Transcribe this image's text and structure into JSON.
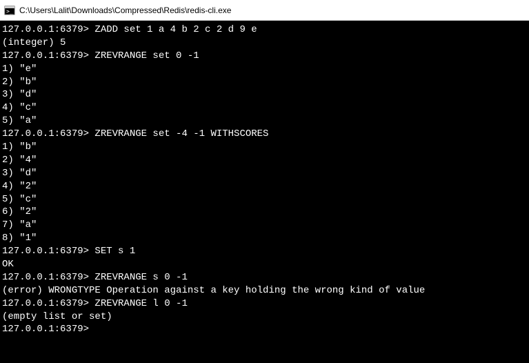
{
  "titlebar": {
    "path": "C:\\Users\\Lalit\\Downloads\\Compressed\\Redis\\redis-cli.exe"
  },
  "terminal": {
    "prompt": "127.0.0.1:6379>",
    "lines": [
      {
        "type": "cmd",
        "text": "ZADD set 1 a 4 b 2 c 2 d 9 e"
      },
      {
        "type": "out",
        "text": "(integer) 5"
      },
      {
        "type": "cmd",
        "text": "ZREVRANGE set 0 -1"
      },
      {
        "type": "out",
        "text": "1) \"e\""
      },
      {
        "type": "out",
        "text": "2) \"b\""
      },
      {
        "type": "out",
        "text": "3) \"d\""
      },
      {
        "type": "out",
        "text": "4) \"c\""
      },
      {
        "type": "out",
        "text": "5) \"a\""
      },
      {
        "type": "cmd",
        "text": "ZREVRANGE set -4 -1 WITHSCORES"
      },
      {
        "type": "out",
        "text": "1) \"b\""
      },
      {
        "type": "out",
        "text": "2) \"4\""
      },
      {
        "type": "out",
        "text": "3) \"d\""
      },
      {
        "type": "out",
        "text": "4) \"2\""
      },
      {
        "type": "out",
        "text": "5) \"c\""
      },
      {
        "type": "out",
        "text": "6) \"2\""
      },
      {
        "type": "out",
        "text": "7) \"a\""
      },
      {
        "type": "out",
        "text": "8) \"1\""
      },
      {
        "type": "cmd",
        "text": "SET s 1"
      },
      {
        "type": "out",
        "text": "OK"
      },
      {
        "type": "cmd",
        "text": "ZREVRANGE s 0 -1"
      },
      {
        "type": "out",
        "text": "(error) WRONGTYPE Operation against a key holding the wrong kind of value"
      },
      {
        "type": "cmd",
        "text": "ZREVRANGE l 0 -1"
      },
      {
        "type": "out",
        "text": "(empty list or set)"
      },
      {
        "type": "cmd",
        "text": ""
      }
    ]
  }
}
